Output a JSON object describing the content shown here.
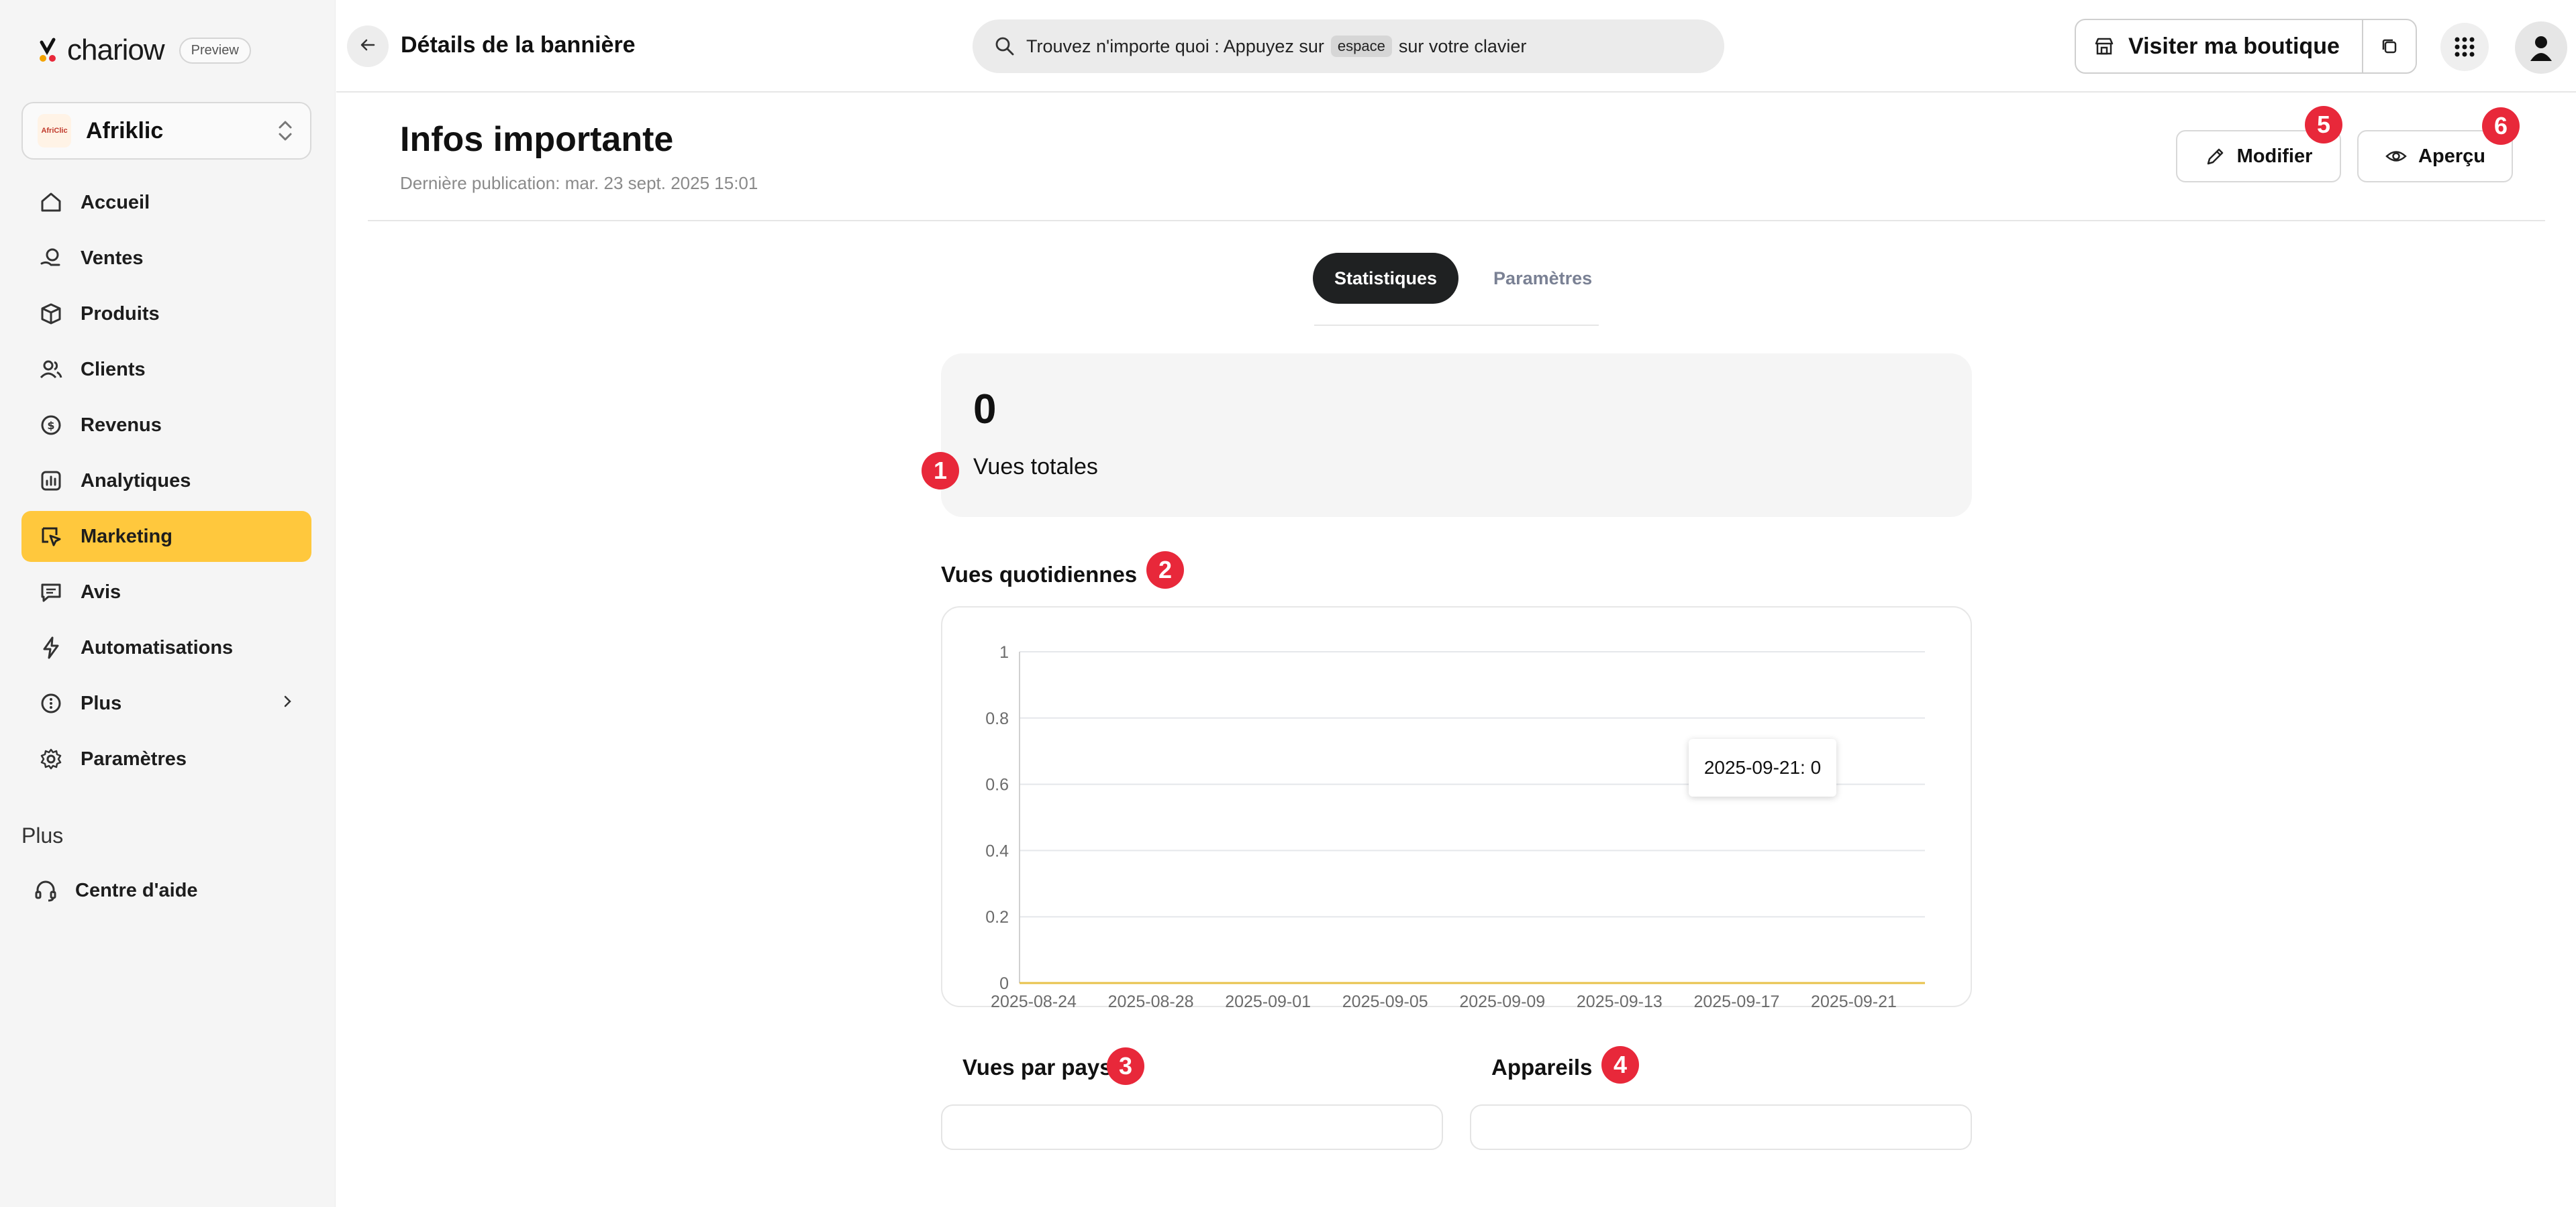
{
  "brand": {
    "name": "chariow",
    "badge": "Preview"
  },
  "store": {
    "name": "Afriklic",
    "avatar_text": "AfriClic"
  },
  "sidebar": {
    "items": [
      {
        "label": "Accueil",
        "icon": "home-icon",
        "active": false
      },
      {
        "label": "Ventes",
        "icon": "sales-icon",
        "active": false
      },
      {
        "label": "Produits",
        "icon": "box-icon",
        "active": false
      },
      {
        "label": "Clients",
        "icon": "users-icon",
        "active": false
      },
      {
        "label": "Revenus",
        "icon": "money-icon",
        "active": false
      },
      {
        "label": "Analytiques",
        "icon": "analytics-icon",
        "active": false
      },
      {
        "label": "Marketing",
        "icon": "marketing-icon",
        "active": true
      },
      {
        "label": "Avis",
        "icon": "chat-icon",
        "active": false
      },
      {
        "label": "Automatisations",
        "icon": "bolt-icon",
        "active": false
      },
      {
        "label": "Plus",
        "icon": "more-icon",
        "active": false
      },
      {
        "label": "Paramètres",
        "icon": "gear-icon",
        "active": false
      }
    ],
    "section_label": "Plus",
    "help_label": "Centre d'aide"
  },
  "topbar": {
    "crumb": "Détails de la bannière",
    "search_prefix": "Trouvez n'importe quoi : Appuyez sur",
    "search_key": "espace",
    "search_suffix": "sur votre clavier",
    "visit_label": "Visiter ma boutique"
  },
  "header": {
    "title": "Infos importante",
    "subtitle": "Dernière publication: mar. 23 sept. 2025 15:01",
    "edit_label": "Modifier",
    "preview_label": "Aperçu"
  },
  "tabs": [
    {
      "label": "Statistiques",
      "active": true
    },
    {
      "label": "Paramètres",
      "active": false
    }
  ],
  "stats": {
    "total_value": "0",
    "total_label": "Vues totales"
  },
  "sections": {
    "daily": "Vues quotidiennes",
    "by_country": "Vues par pays",
    "devices": "Appareils"
  },
  "badges": [
    "1",
    "2",
    "3",
    "4",
    "5",
    "6"
  ],
  "tooltip": "2025-09-21: 0",
  "colors": {
    "accent": "#ffc83d",
    "badge": "#e8283a",
    "series": "#e8c24a",
    "grid": "#e5e7eb"
  },
  "chart_data": {
    "type": "line",
    "x": [
      "2025-08-24",
      "2025-08-28",
      "2025-09-01",
      "2025-09-05",
      "2025-09-09",
      "2025-09-13",
      "2025-09-17",
      "2025-09-21"
    ],
    "values": [
      0,
      0,
      0,
      0,
      0,
      0,
      0,
      0
    ],
    "yticks": [
      "0",
      "0.2",
      "0.4",
      "0.6",
      "0.8",
      "1"
    ],
    "ylim": [
      0,
      1
    ],
    "grid": true,
    "legend": "none"
  }
}
